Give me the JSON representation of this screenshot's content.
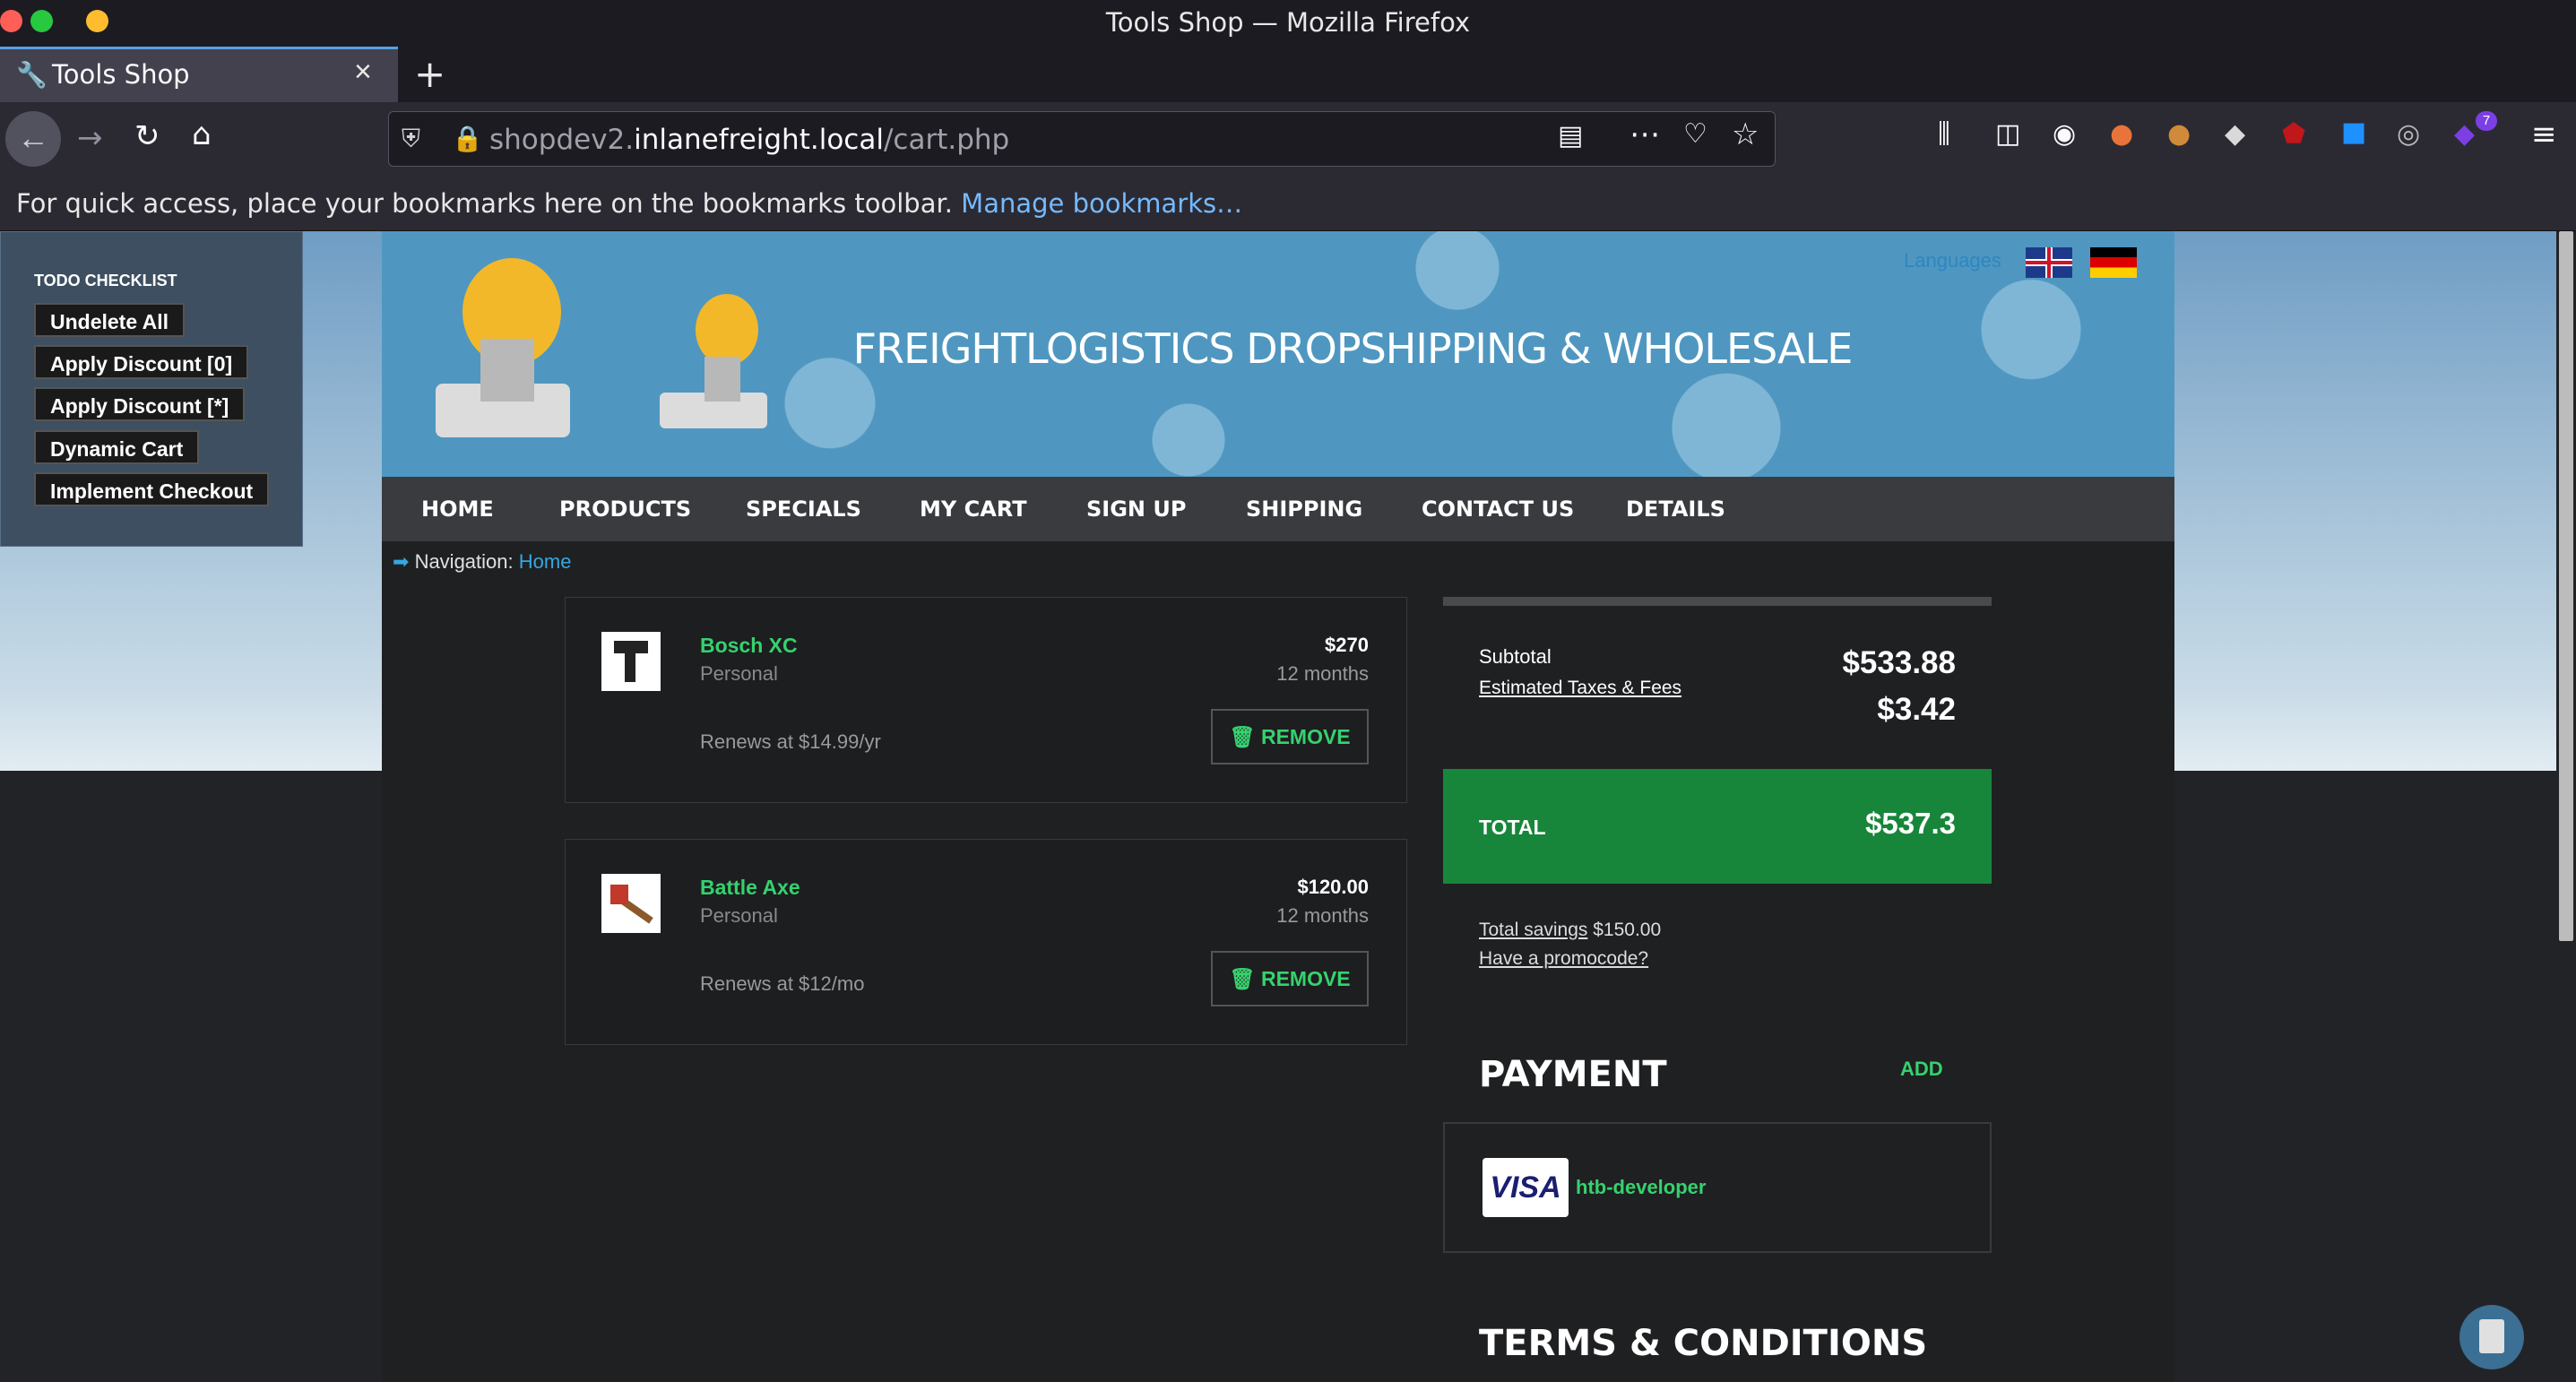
{
  "window": {
    "title": "Tools Shop — Mozilla Firefox"
  },
  "tab": {
    "title": "Tools Shop",
    "close": "×",
    "new_tab": "+"
  },
  "url": {
    "domain_prefix": "shopdev2.",
    "domain": "inlanefreight.local",
    "path": "/cart.php"
  },
  "bookmarks": {
    "message": "For quick access, place your bookmarks here on the bookmarks toolbar.",
    "manage_link": "Manage bookmarks…"
  },
  "extension_badge": "7",
  "todo": {
    "title": "TODO CHECKLIST",
    "items": [
      "Undelete All",
      "Apply Discount [0]",
      "Apply Discount [*]",
      "Dynamic Cart",
      "Implement Checkout"
    ]
  },
  "site": {
    "title": "FREIGHTLOGISTICS DROPSHIPPING & WHOLESALE",
    "languages_label": "Languages"
  },
  "menu": [
    "HOME",
    "PRODUCTS",
    "SPECIALS",
    "MY CART",
    "SIGN UP",
    "SHIPPING",
    "CONTACT US",
    "DETAILS"
  ],
  "breadcrumb": {
    "label": "Navigation:",
    "link": "Home"
  },
  "cart": [
    {
      "name": "Bosch XC",
      "plan": "Personal",
      "price": "$270",
      "term": "12 months",
      "renew": "Renews at $14.99/yr",
      "remove": "REMOVE"
    },
    {
      "name": "Battle Axe",
      "plan": "Personal",
      "price": "$120.00",
      "term": "12 months",
      "renew": "Renews at $12/mo",
      "remove": "REMOVE"
    }
  ],
  "summary": {
    "subtotal_label": "Subtotal",
    "taxes_label": "Estimated Taxes & Fees",
    "subtotal_value": "$533.88",
    "taxes_value": "$3.42",
    "total_label": "TOTAL",
    "total_value": "$537.3",
    "savings_label": "Total savings",
    "savings_value": "$150.00",
    "promo_link": "Have a promocode?"
  },
  "payment": {
    "heading": "PAYMENT",
    "add": "ADD",
    "card_brand": "VISA",
    "card_name": "htb-developer"
  },
  "terms_heading": "TERMS & CONDITIONS",
  "colors": {
    "accent_green": "#35d26e",
    "total_green": "#17863a",
    "link_blue": "#35a8e0"
  }
}
